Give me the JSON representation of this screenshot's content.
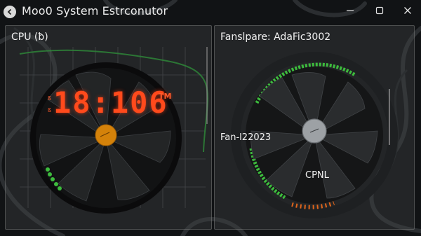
{
  "window": {
    "title": "Moo0 System Estrconutor",
    "controls": [
      "minimize-icon",
      "maximize-icon",
      "close-icon"
    ]
  },
  "cpu_panel": {
    "title": "CPU (ƀ)",
    "clock": "18:106",
    "clock_suffix": "TM",
    "clock_prefix_top": "ß",
    "clock_prefix_bottom": "ß"
  },
  "fan_panel": {
    "title": "Fanslpare: AdaFic3002",
    "fan_id": "Fan-l22023",
    "cpu_label": "CPNL"
  },
  "colors": {
    "clock": "#ff4a1c",
    "green_led": "#3dbb3d",
    "orange_hub": "#d4820a",
    "panel_border": "#8c8c8c"
  }
}
